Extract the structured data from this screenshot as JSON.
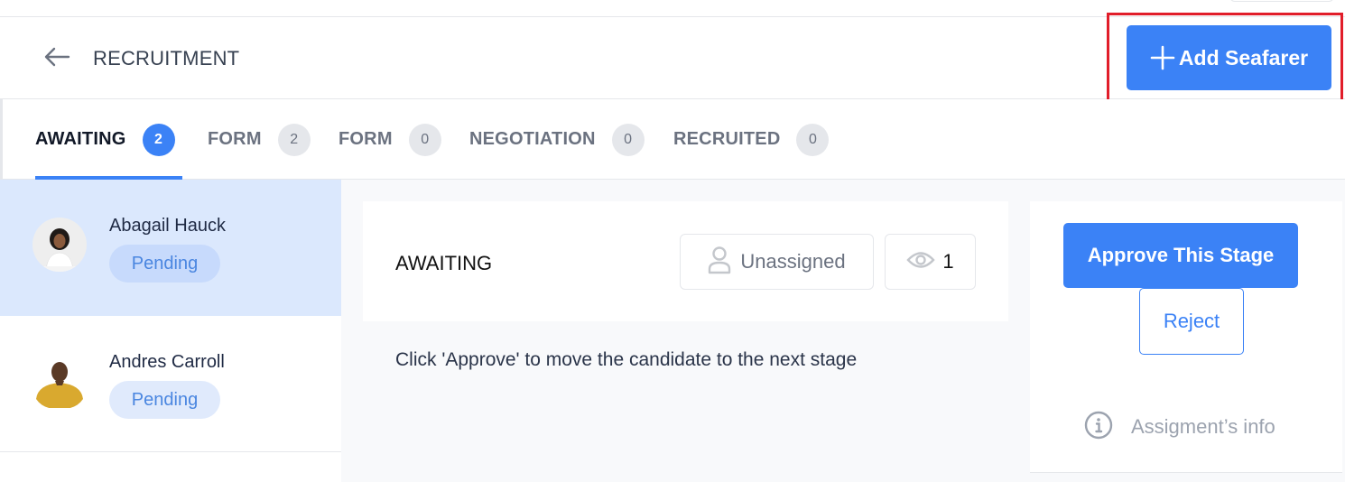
{
  "header": {
    "title": "RECRUITMENT",
    "back_icon": "arrow-left-icon",
    "add_button_label": "Add Seafarer",
    "add_button_icon": "plus-icon"
  },
  "colors": {
    "primary": "#3b82f6",
    "highlight_border": "#e11d2a",
    "selected_row": "#dbe8fd",
    "badge_bg": "#c7dafc",
    "badge_text": "#4a86e0"
  },
  "tabs": [
    {
      "label": "AWAITING",
      "count": "2",
      "active": true
    },
    {
      "label": "FORM",
      "count": "2",
      "active": false
    },
    {
      "label": "FORM",
      "count": "0",
      "active": false
    },
    {
      "label": "NEGOTIATION",
      "count": "0",
      "active": false
    },
    {
      "label": "RECRUITED",
      "count": "0",
      "active": false
    }
  ],
  "candidates": [
    {
      "name": "Abagail Hauck",
      "status": "Pending",
      "selected": true
    },
    {
      "name": "Andres Carroll",
      "status": "Pending",
      "selected": false
    }
  ],
  "stage": {
    "title": "AWAITING",
    "assignee_label": "Unassigned",
    "assignee_icon": "user-icon",
    "views_icon": "eye-icon",
    "views_count": "1",
    "instruction": "Click 'Approve' to move the candidate to the next stage"
  },
  "actions": {
    "approve_label": "Approve This Stage",
    "reject_label": "Reject",
    "info_icon": "info-icon",
    "info_label": "Assigment’s info"
  }
}
